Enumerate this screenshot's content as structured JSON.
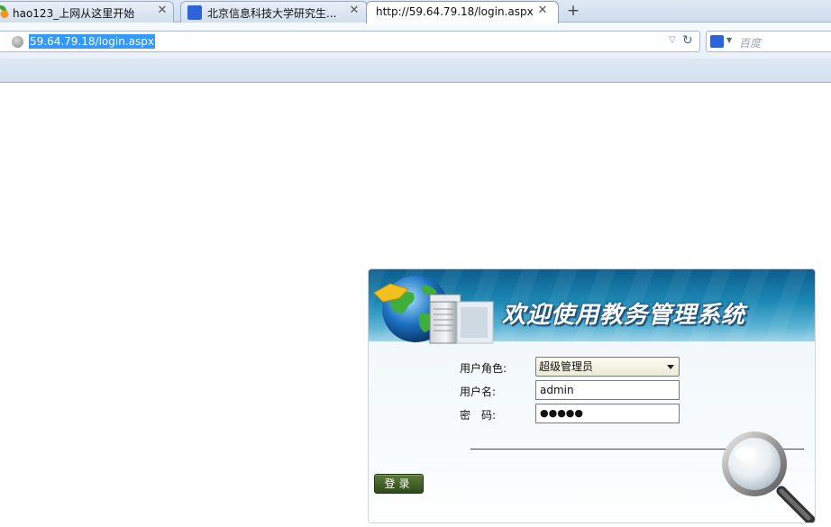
{
  "browser": {
    "tabs": [
      {
        "title": "hao123_上网从这里开始",
        "favicon": "hao123-icon",
        "active": false
      },
      {
        "title": "北京信息科技大学研究生...",
        "favicon": "baidu-paw-icon",
        "active": false
      },
      {
        "title": "http://59.64.79.18/login.aspx",
        "favicon": "",
        "active": true
      }
    ],
    "close_glyph": "✕",
    "new_tab_glyph": "+",
    "address": "59.64.79.18/login.aspx",
    "search_placeholder": "百度",
    "icons": {
      "address_site": "globe-icon",
      "address_dropdown": "dropdown-arrow-icon",
      "reload": "reload-icon",
      "search_engine": "baidu-paw-icon"
    }
  },
  "login": {
    "banner_title": "欢迎使用教务管理系统",
    "role_label": "用户角色:",
    "role_value": "超级管理员",
    "username_label": "用户名:",
    "username_value": "admin",
    "password_label": "密　码:",
    "password_value": "●●●●●",
    "submit_label": "登录"
  },
  "colors": {
    "banner_dark": "#0d5e8e",
    "banner_light": "#9fd3e6",
    "address_highlight": "#3399ff",
    "login_button": "#2e4a1b"
  }
}
